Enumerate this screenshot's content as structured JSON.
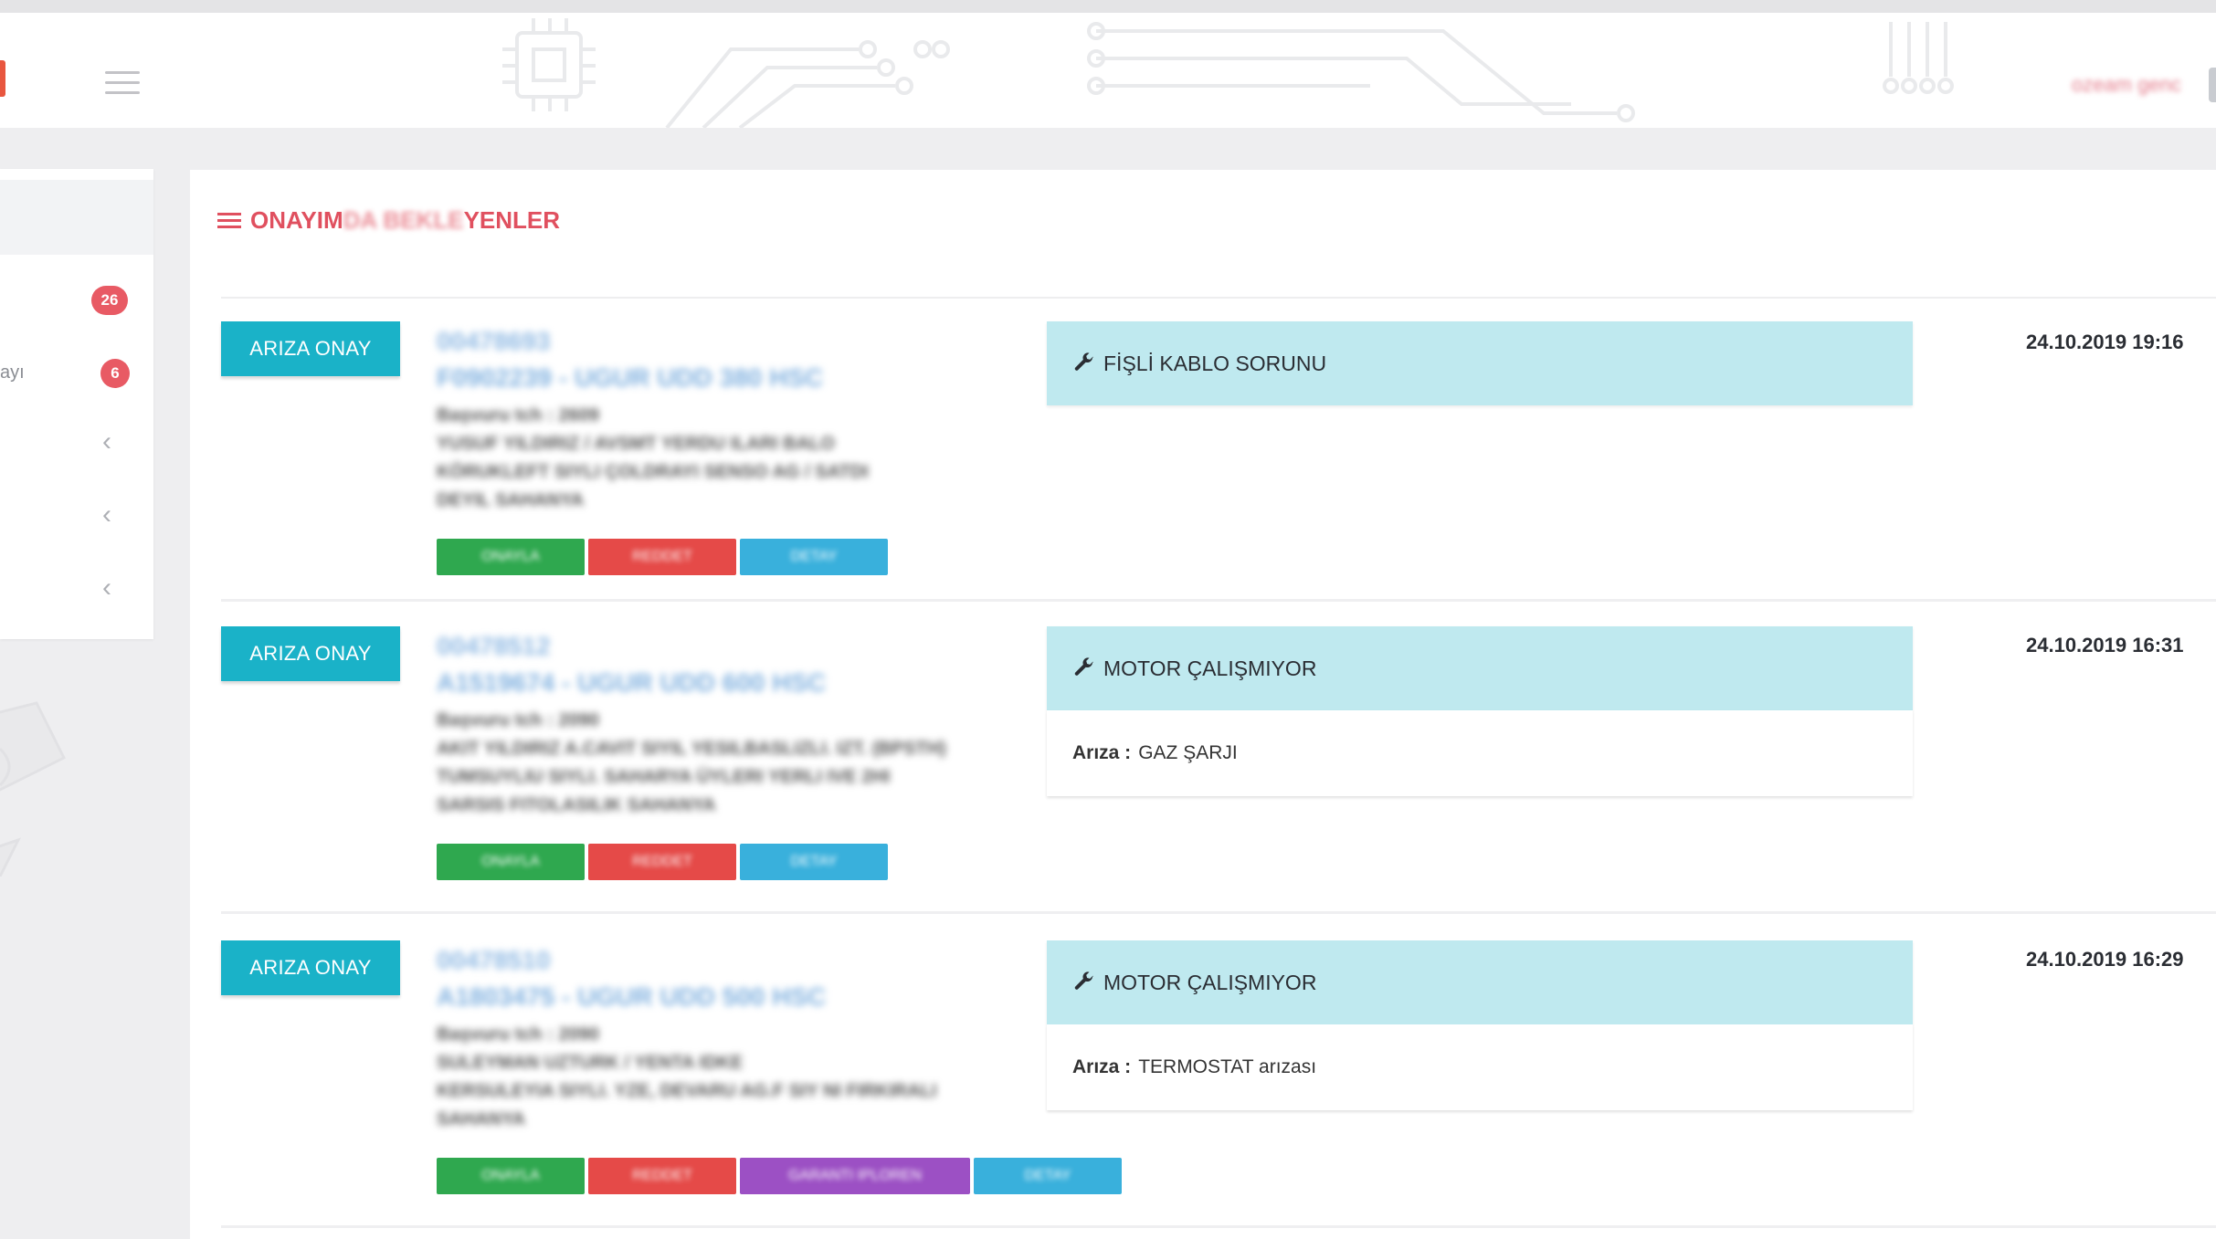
{
  "header": {
    "user_name": "ozeam genc"
  },
  "sidebar": {
    "items": [
      {
        "label": "",
        "badge": "26"
      },
      {
        "label": "ayı",
        "badge": "6"
      },
      {
        "label": "",
        "chevron": "‹"
      },
      {
        "label": "",
        "chevron": "‹"
      },
      {
        "label": "",
        "chevron": "‹"
      }
    ]
  },
  "panel": {
    "title_visible_a": "ONAYIM",
    "title_blurred": "DA BEKLE",
    "title_visible_b": "YENLER"
  },
  "colors": {
    "accent_red": "#e0505f",
    "ariza_button": "#1ab2c8",
    "issue_header_bg": "#bfe9ef",
    "approve": "#2fa84f",
    "reject": "#e54a48",
    "detail": "#39b0dc",
    "warranty": "#9c50c4"
  },
  "records": [
    {
      "badge_label": "ARIZA ONAY",
      "id": "00478693",
      "model": "F0902239 -   UGUR UDD 380 HSC",
      "lines": [
        "Başvuru tch : 2609",
        "YUSUF YILDIRIZ / AVSMT YERDU ILARI BALO",
        "KÖRUKLEFT SIYLI ÇOLDRAYI SENSO AG / SATDI",
        "DEYIL SAHANYA"
      ],
      "actions": [
        {
          "label": "ONAYLA",
          "color": "green"
        },
        {
          "label": "REDDET",
          "color": "red"
        },
        {
          "label": "DETAY",
          "color": "blue"
        }
      ],
      "issue_title": "FİŞLİ KABLO SORUNU",
      "fault_label": "",
      "fault_value": "",
      "timestamp": "24.10.2019 19:16"
    },
    {
      "badge_label": "ARIZA ONAY",
      "id": "00478512",
      "model": "A1519674 -   UGUR UDD 600 HSC",
      "lines": [
        "Başvuru tch : 2090",
        "AKIT YILDIRIZ A.CAVIT SIYIL YESILBASLIZLI. IZT. (BPSTH)",
        "TUMSUYLIU SIYLI. SAHARYA ÜYLERI YERLI IVE 2HI",
        "SARSIS FITOLASILIK SAHANYA"
      ],
      "actions": [
        {
          "label": "ONAYLA",
          "color": "green"
        },
        {
          "label": "REDDET",
          "color": "red"
        },
        {
          "label": "DETAY",
          "color": "blue"
        }
      ],
      "issue_title": "MOTOR ÇALIŞMIYOR",
      "fault_label": "Arıza :",
      "fault_value": "GAZ ŞARJI",
      "timestamp": "24.10.2019 16:31"
    },
    {
      "badge_label": "ARIZA ONAY",
      "id": "00478510",
      "model": "A1803475 -   UGUR UDD 500 HSC",
      "lines": [
        "Başvuru tch : 2090",
        "SULEYMAN UZTURK / YENTA IDKE",
        "KERSULEYIA SIYLI. YZE, DEVARU AG.F SIY NI FIRKIRALI",
        "SAHANYA"
      ],
      "actions": [
        {
          "label": "ONAYLA",
          "color": "green"
        },
        {
          "label": "REDDET",
          "color": "red"
        },
        {
          "label": "GARANTI IPLOREN",
          "color": "purple"
        },
        {
          "label": "DETAY",
          "color": "blue"
        }
      ],
      "issue_title": "MOTOR ÇALIŞMIYOR",
      "fault_label": "Arıza :",
      "fault_value": "TERMOSTAT arızası",
      "timestamp": "24.10.2019 16:29"
    }
  ]
}
